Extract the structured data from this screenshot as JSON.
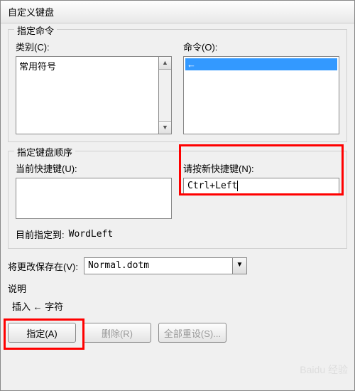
{
  "window": {
    "title": "自定义键盘"
  },
  "group_command": {
    "title": "指定命令",
    "category_label": "类别(C):",
    "category_items": [
      "常用符号"
    ],
    "command_label": "命令(O):",
    "command_selected": "←"
  },
  "group_sequence": {
    "title": "指定键盘顺序",
    "current_label": "当前快捷键(U):",
    "new_label": "请按新快捷键(N):",
    "new_value": "Ctrl+Left",
    "assigned_to_label": "目前指定到:",
    "assigned_to_value": "WordLeft"
  },
  "save_in": {
    "label": "将更改保存在(V):",
    "value": "Normal.dotm"
  },
  "description": {
    "label": "说明",
    "text": "插入 ← 字符"
  },
  "buttons": {
    "assign": "指定(A)",
    "remove": "删除(R)",
    "reset": "全部重设(S)..."
  },
  "watermark": "Baidu 经验"
}
